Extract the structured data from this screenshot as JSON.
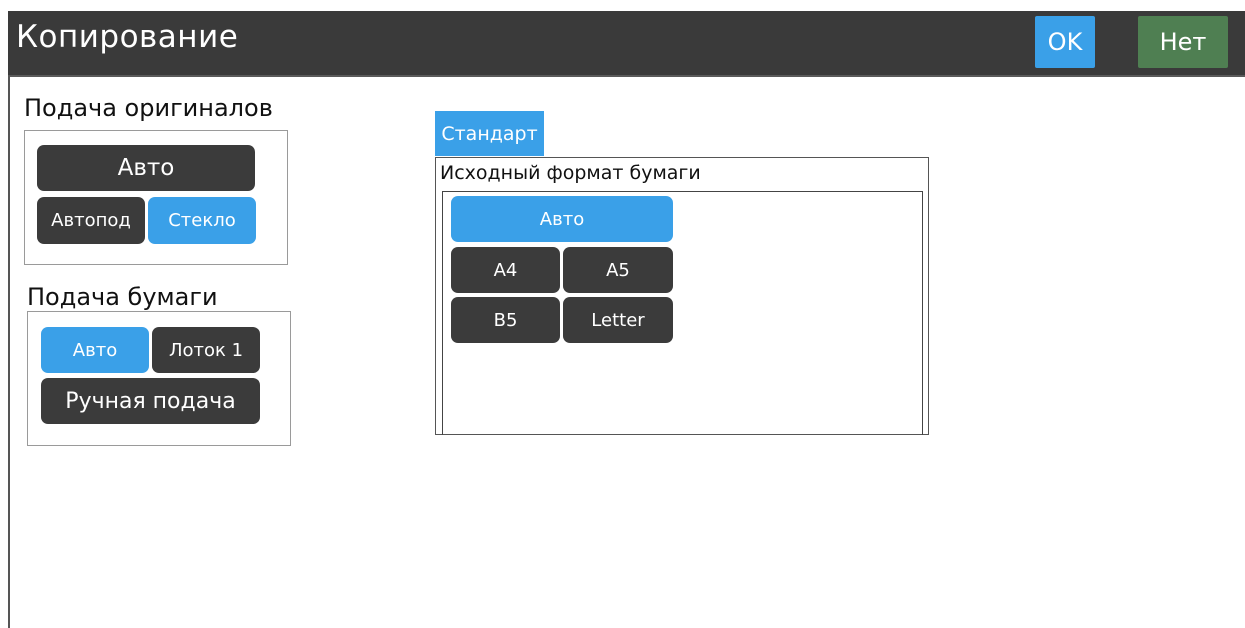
{
  "window": {
    "title": "Копирование",
    "ok_label": "OK",
    "no_label": "Нет"
  },
  "original_feed": {
    "heading": "Подача оригиналов",
    "auto": "Авто",
    "adf": "Автопод",
    "glass": "Стекло",
    "selected": "Стекло"
  },
  "paper_feed": {
    "heading": "Подача бумаги",
    "auto": "Авто",
    "tray1": "Лоток 1",
    "manual": "Ручная подача",
    "selected": "Авто"
  },
  "format_tabs": {
    "standard": "Стандарт"
  },
  "original_size": {
    "heading": "Исходный формат бумаги",
    "auto": "Авто",
    "a4": "A4",
    "a5": "A5",
    "b5": "B5",
    "letter": "Letter",
    "selected": "Авто"
  },
  "colors": {
    "accent": "#3aa0e8",
    "dark_button": "#3b3b3b",
    "titlebar": "#3a3a3a",
    "cancel_green": "#4f7f52"
  }
}
